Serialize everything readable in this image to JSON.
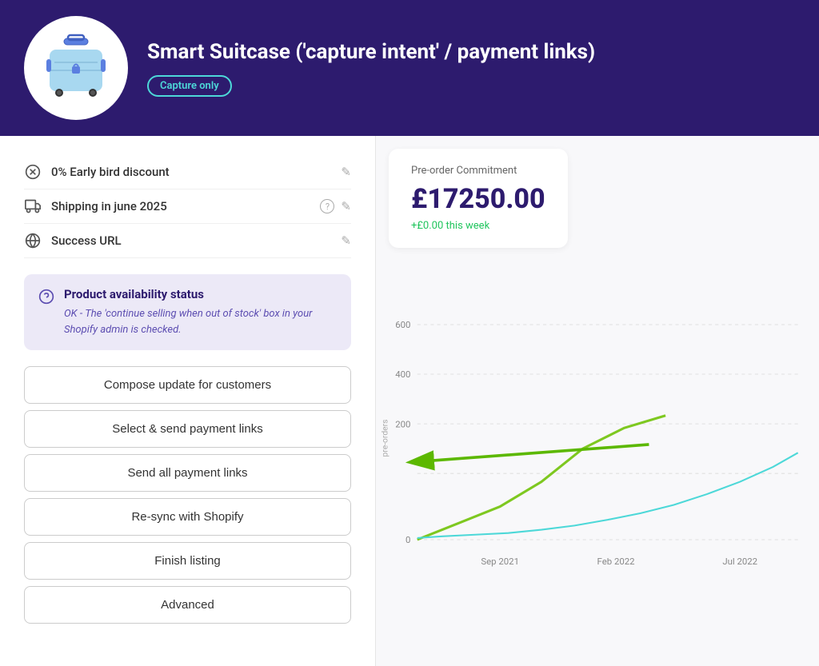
{
  "header": {
    "title": "Smart Suitcase ('capture intent' / payment links)",
    "badge": "Capture only"
  },
  "details": [
    {
      "icon": "discount-icon",
      "text": "0% Early bird discount",
      "hasHelp": false,
      "hasEdit": true
    },
    {
      "icon": "shipping-icon",
      "text": "Shipping in june 2025",
      "hasHelp": true,
      "hasEdit": true
    },
    {
      "icon": "url-icon",
      "text": "Success URL",
      "hasHelp": false,
      "hasEdit": true
    }
  ],
  "status_box": {
    "title": "Product availability status",
    "text": "OK - The 'continue selling when out of stock' box in your Shopify admin is checked."
  },
  "buttons": [
    {
      "label": "Compose update for customers"
    },
    {
      "label": "Select & send payment links"
    },
    {
      "label": "Send all payment links"
    },
    {
      "label": "Re-sync with Shopify"
    },
    {
      "label": "Finish listing"
    },
    {
      "label": "Advanced"
    }
  ],
  "stats": {
    "label": "Pre-order Commitment",
    "value": "£17250.00",
    "delta": "+£0.00 this week"
  },
  "chart": {
    "y_labels": [
      "600",
      "400",
      "200",
      "0"
    ],
    "x_labels": [
      "Sep 2021",
      "Feb 2022",
      "Jul 2022"
    ],
    "y_axis_title": "pre-orders"
  }
}
